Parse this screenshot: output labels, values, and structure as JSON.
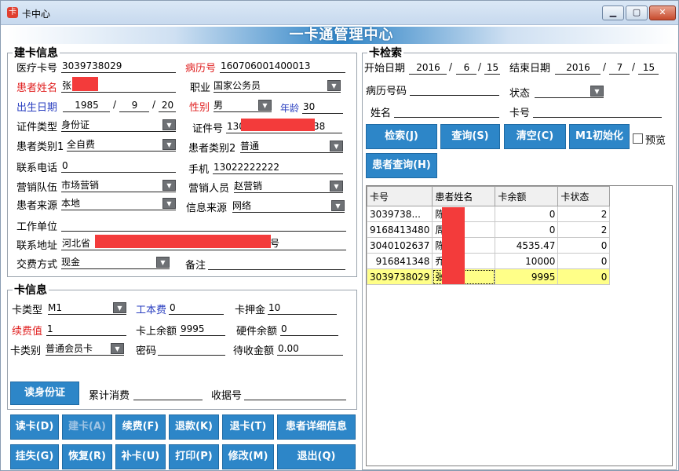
{
  "window": {
    "title": "卡中心",
    "min": "▁",
    "max": "▢",
    "close": "✕",
    "banner": "一卡通管理中心"
  },
  "build": {
    "legend": "建卡信息",
    "card_no_label": "医疗卡号",
    "card_no": "3039738029",
    "record_no_label": "病历号",
    "record_no": "160706001400013",
    "name_label": "患者姓名",
    "name": "张",
    "job_label": "职业",
    "job": "国家公务员",
    "birth_label": "出生日期",
    "birth_y": "1985",
    "birth_m": "9",
    "birth_d": "20",
    "sex_label": "性别",
    "sex": "男",
    "age_label": "年龄",
    "age": "30",
    "idtype_label": "证件类型",
    "idtype": "身份证",
    "idno_label": "证件号",
    "idno_prefix": "130",
    "idno_suffix": "38",
    "cat1_label": "患者类别1",
    "cat1": "全自费",
    "cat2_label": "患者类别2",
    "cat2": "普通",
    "phone_label": "联系电话",
    "phone": "0",
    "mobile_label": "手机",
    "mobile": "13022222222",
    "team_label": "营销队伍",
    "team": "市场营销",
    "staff_label": "营销人员",
    "staff": "赵营销",
    "source_label": "患者来源",
    "source": "本地",
    "info_label": "信息来源",
    "info": "网络",
    "work_label": "工作单位",
    "addr_label": "联系地址",
    "addr_prefix": "河北省",
    "addr_suffix": "号",
    "pay_label": "交费方式",
    "pay": "现金",
    "note_label": "备注"
  },
  "card": {
    "legend": "卡信息",
    "type_label": "卡类型",
    "type": "M1",
    "cost_label": "工本费",
    "cost": "0",
    "deposit_label": "卡押金",
    "deposit": "10",
    "renew_label": "续费值",
    "renew": "1",
    "balance_label": "卡上余额",
    "balance": "9995",
    "hw_label": "硬件余额",
    "hw": "0",
    "class_label": "卡类别",
    "class": "普通会员卡",
    "pwd_label": "密码",
    "pending_label": "待收金额",
    "pending": "0.00",
    "read_id": "读身份证",
    "total_label": "累计消费",
    "receipt_label": "收据号"
  },
  "buttons": {
    "read": "读卡(D)",
    "build": "建卡(A)",
    "renew": "续费(F)",
    "refund": "退款(K)",
    "return": "退卡(T)",
    "detail": "患者详细信息",
    "lost": "挂失(G)",
    "restore": "恢复(R)",
    "reissue": "补卡(U)",
    "print": "打印(P)",
    "modify": "修改(M)",
    "exit": "退出(Q)"
  },
  "search": {
    "legend": "卡检索",
    "start_label": "开始日期",
    "start_y": "2016",
    "start_m": "6",
    "start_d": "15",
    "end_label": "结束日期",
    "end_y": "2016",
    "end_m": "7",
    "end_d": "15",
    "record_label": "病历号码",
    "status_label": "状态",
    "name_label": "姓名",
    "card_label": "卡号",
    "btn_search": "检索(J)",
    "btn_query": "查询(S)",
    "btn_clear": "清空(C)",
    "btn_init": "M1初始化",
    "preview": "预览",
    "btn_patient": "患者查询(H)"
  },
  "table": {
    "headers": [
      "卡号",
      "患者姓名",
      "卡余额",
      "卡状态"
    ],
    "rows": [
      {
        "card": "3039738...",
        "name": "陈",
        "balance": "0",
        "status": "2"
      },
      {
        "card": "9168413480",
        "name": "周",
        "balance": "0",
        "status": "2"
      },
      {
        "card": "3040102637",
        "name": "陈",
        "balance": "4535.47",
        "status": "0"
      },
      {
        "card": "916841348",
        "name": "乔",
        "balance": "10000",
        "status": "0"
      },
      {
        "card": "3039738029",
        "name": "张",
        "balance": "9995",
        "status": "0"
      }
    ]
  },
  "colors": {
    "button": "#2d86c8",
    "highlight": "#ffff88",
    "mask": "#f33b3b",
    "label_red": "#e02020",
    "label_blue": "#2a3fc0"
  }
}
